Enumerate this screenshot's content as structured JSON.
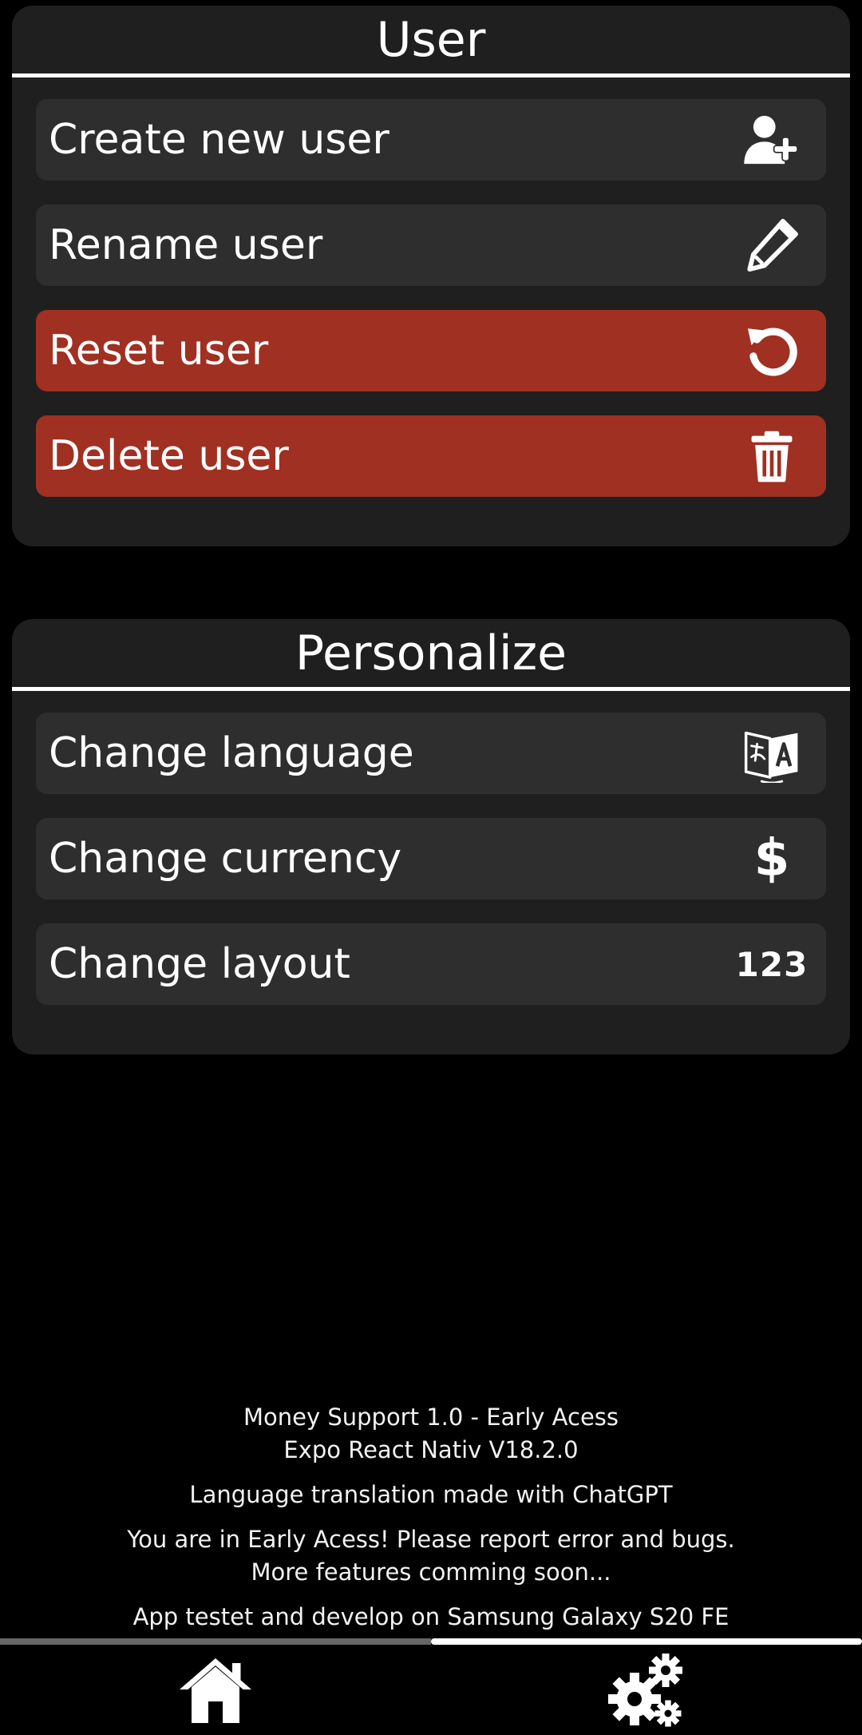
{
  "user_section": {
    "title": "User",
    "items": [
      {
        "label": "Create new user",
        "icon": "add-user-icon"
      },
      {
        "label": "Rename user",
        "icon": "pencil-icon"
      },
      {
        "label": "Reset user",
        "icon": "reset-icon",
        "style": "danger"
      },
      {
        "label": "Delete user",
        "icon": "trash-icon",
        "style": "danger"
      }
    ]
  },
  "personalize_section": {
    "title": "Personalize",
    "items": [
      {
        "label": "Change language",
        "icon": "translate-icon"
      },
      {
        "label": "Change currency",
        "icon": "dollar-icon",
        "icon_text": "$"
      },
      {
        "label": "Change layout",
        "icon": "numbers-icon",
        "icon_text": "123"
      }
    ]
  },
  "footer": {
    "app_version": "Money Support 1.0 - Early Acess",
    "framework": "Expo React Nativ V18.2.0",
    "translation_note": "Language translation made with ChatGPT",
    "early_access_note": "You are in Early Acess! Please report error and bugs.",
    "coming_soon": "More features comming soon...",
    "device_note": "App testet and develop on Samsung Galaxy S20 FE"
  },
  "tabbar": {
    "tabs": [
      {
        "icon": "home-icon",
        "active": false
      },
      {
        "icon": "gears-icon",
        "active": true
      }
    ]
  },
  "colors": {
    "background": "#000000",
    "panel": "#1f1f1f",
    "row": "#2e2e2e",
    "danger": "#a03022",
    "text": "#ffffff",
    "inactive_tab": "#666666"
  }
}
